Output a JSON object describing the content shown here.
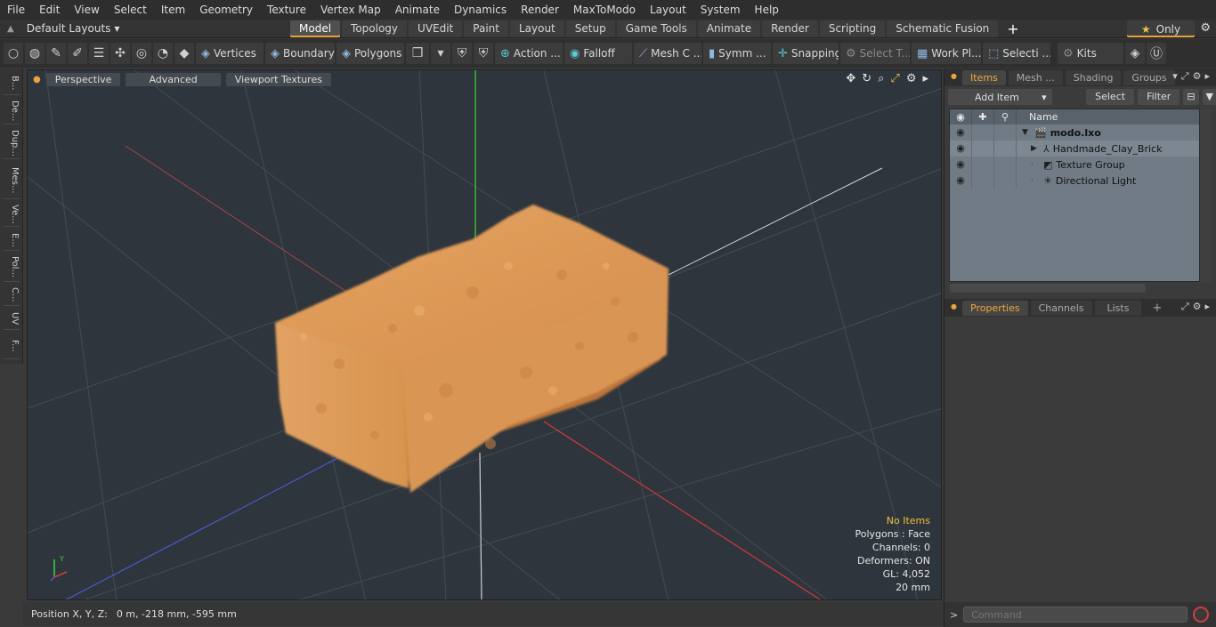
{
  "menu": [
    "File",
    "Edit",
    "View",
    "Select",
    "Item",
    "Geometry",
    "Texture",
    "Vertex Map",
    "Animate",
    "Dynamics",
    "Render",
    "MaxToModo",
    "Layout",
    "System",
    "Help"
  ],
  "layouts": {
    "default_label": "Default Layouts",
    "tabs": [
      "Model",
      "Topology",
      "UVEdit",
      "Paint",
      "Layout",
      "Setup",
      "Game Tools",
      "Animate",
      "Render",
      "Scripting",
      "Schematic Fusion"
    ],
    "active_tab": "Model",
    "plus": "+",
    "only_label": "Only"
  },
  "toolbar": {
    "vertices": "Vertices",
    "boundary": "Boundary",
    "polygons": "Polygons",
    "action": "Action ...",
    "falloff": "Falloff",
    "mesh_c": "Mesh C ...",
    "symm": "Symm ...",
    "snapping": "Snapping",
    "select_t": "Select T...",
    "work_pl": "Work Pl...",
    "selecti": "Selecti ...",
    "kits": "Kits"
  },
  "left_tabs": [
    "B...",
    "De...",
    "Dup...",
    "Mes...",
    "Ve...",
    "E...",
    "Pol...",
    "C...",
    "UV",
    "F..."
  ],
  "viewport": {
    "perspective": "Perspective",
    "advanced": "Advanced",
    "viewport_textures": "Viewport Textures",
    "info": {
      "no_items": "No Items",
      "polygons": "Polygons : Face",
      "channels": "Channels: 0",
      "deformers": "Deformers: ON",
      "gl": "GL: 4,052",
      "scale": "20 mm"
    },
    "gizmo_x": "X",
    "gizmo_y": "Y"
  },
  "status": {
    "label": "Position X, Y, Z:",
    "value": "0 m, -218 mm, -595 mm"
  },
  "items_panel": {
    "tabs": [
      "Items",
      "Mesh ...",
      "Shading",
      "Groups"
    ],
    "active_tab": "Items",
    "add_item": "Add Item",
    "select": "Select",
    "filter": "Filter",
    "column_name": "Name",
    "tree": [
      {
        "label": "modo.lxo",
        "icon": "scene-icon",
        "root": true
      },
      {
        "label": "Handmade_Clay_Brick",
        "icon": "mesh-icon"
      },
      {
        "label": "Texture Group",
        "icon": "texture-group-icon"
      },
      {
        "label": "Directional Light",
        "icon": "light-icon"
      }
    ]
  },
  "properties_panel": {
    "tabs": [
      "Properties",
      "Channels",
      "Lists"
    ],
    "active_tab": "Properties",
    "plus": "+"
  },
  "command": {
    "placeholder": "Command"
  },
  "colors": {
    "accent": "#e8a33c",
    "viewport_bg": "#2f353c",
    "brick": "#d9914f",
    "axis_x": "#d04040",
    "axis_y": "#40d040",
    "axis_z": "#4a5ad0"
  }
}
